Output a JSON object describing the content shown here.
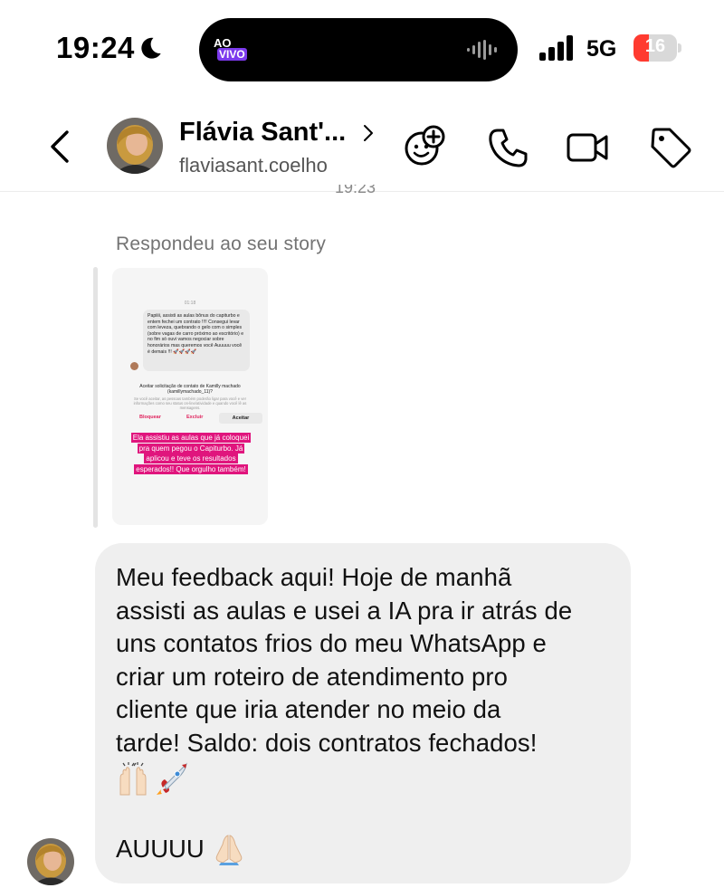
{
  "status_bar": {
    "time": "19:24",
    "live_badge_top": "AO",
    "live_badge_bottom": "VIVO",
    "network": "5G",
    "battery_level": "16",
    "battery_percent": 16
  },
  "header": {
    "contact_name": "Flávia Sant'...",
    "contact_handle": "flaviasant.coelho",
    "icons": [
      "back-icon",
      "add-effect-icon",
      "phone-icon",
      "video-icon",
      "tag-icon"
    ]
  },
  "thread": {
    "timestamp": "19:23",
    "story_label": "Respondeu ao seu story",
    "story_thumbnail": {
      "time": "01:18",
      "message": "Papiiii, assisti as aulas bônus do capiturbo e entem fechei um contrato !!!! Consegui levar com leveza, quebrando o gelo com o simples (sobre vagas de carro próximo ao escritório) e no fim só ouvi vamos negociar sobre honorários mas queremos você Auuuuu você é demais !!! 🚀🚀🚀🚀",
      "request_title": "Aceitar solicitação de contato de Kamilly machado (kamillymachado_11)?",
      "request_note": "Se você aceitar, as pessoas também poderão ligar para você e ver informações como seu status on-line/atividade e quando você lê as mensagens.",
      "buttons": [
        "Bloquear",
        "Excluir",
        "Aceitar"
      ],
      "caption": "Ela assistiu as aulas que já coloquei pra quem pegou o Capiturbo. Já aplicou e teve os resultados esperados!! Que orgulho também!"
    },
    "message": {
      "text": "Meu feedback aqui! Hoje de manhã\nassisti as aulas e usei a IA pra ir atrás de\nuns contatos frios do meu WhatsApp e\ncriar um roteiro de atendimento pro\ncliente que iria atender no meio da\ntarde! Saldo: dois contratos fechados!",
      "emojis": [
        "raising-hands-emoji",
        "rocket-emoji"
      ],
      "closing": "AUUUU",
      "closing_emoji": "folded-hands-emoji"
    }
  },
  "colors": {
    "bubble": "#efefef",
    "muted_text": "#737373",
    "battery_low": "#ff3b30",
    "caption_pink": "#e0157d"
  }
}
